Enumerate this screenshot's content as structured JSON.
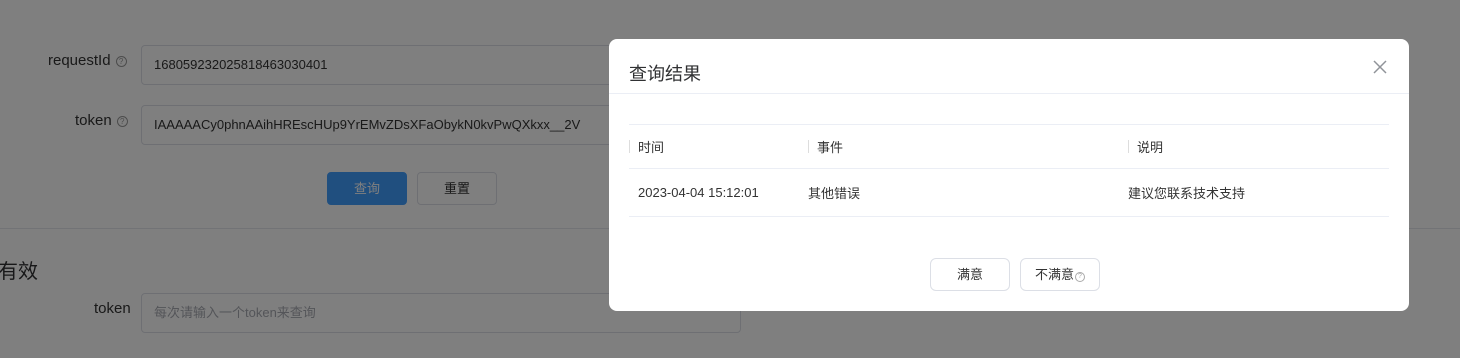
{
  "form": {
    "request_id_label": "requestId",
    "request_id_value": "1680592320258184630304​01",
    "token_label": "token",
    "token_value": "IAAAAACy0phnAAihHREscHUp9YrEMvZDsXFaObykN0kvPwQXkxx__2V",
    "query_button": "查询",
    "reset_button": "重置"
  },
  "section": {
    "title_fragment": "有效",
    "token_label": "token",
    "token_placeholder": "每次请输入一个token来查询"
  },
  "dialog": {
    "title": "查询结果",
    "columns": [
      "时间",
      "事件",
      "说明"
    ],
    "rows": [
      {
        "time": "2023-04-04 15:12:01",
        "event": "其他错误",
        "note": "建议您联系技术支持"
      }
    ],
    "satisfied_button": "满意",
    "unsatisfied_button": "不满意"
  },
  "icons": {
    "help": "question-circle-icon",
    "close": "close-icon"
  },
  "colors": {
    "primary": "#409eff",
    "overlay": "rgba(0,0,0,0.5)"
  }
}
